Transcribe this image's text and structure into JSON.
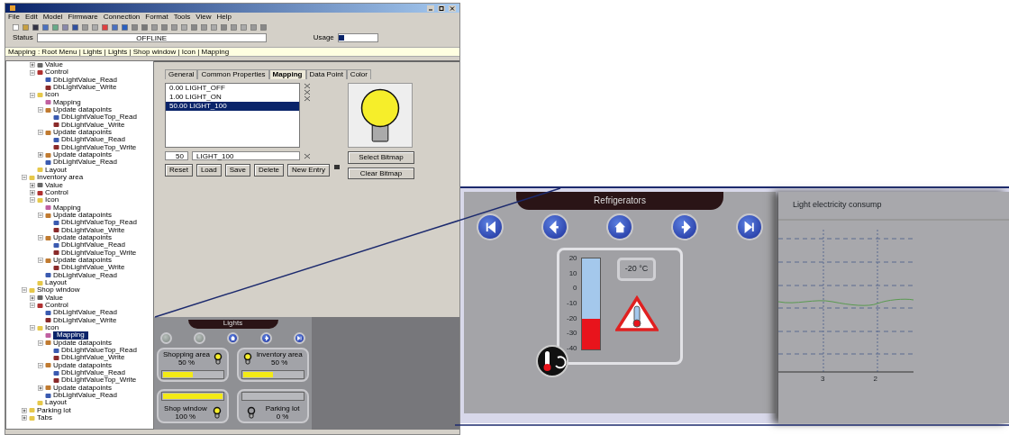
{
  "menu": [
    "File",
    "Edit",
    "Model",
    "Firmware",
    "Connection",
    "Format",
    "Tools",
    "View",
    "Help"
  ],
  "status_row": {
    "label": "Status",
    "value": "OFFLINE",
    "usage_label": "Usage"
  },
  "breadcrumb": "Mapping : Root Menu | Lights | Lights | Shop window | Icon | Mapping",
  "tree": {
    "continued_children": [
      {
        "label": "Value",
        "kind": "value",
        "expanded": false,
        "selected": false
      },
      {
        "label": "Control",
        "kind": "control",
        "expanded": true,
        "selected": false,
        "children": [
          {
            "label": "DbLightValue_Read",
            "kind": "read",
            "selected": false
          },
          {
            "label": "DbLightValue_Write",
            "kind": "write",
            "selected": false
          }
        ]
      },
      {
        "label": "Icon",
        "kind": "icon",
        "expanded": true,
        "selected": false,
        "children": [
          {
            "label": "Mapping",
            "kind": "mapping",
            "selected": false
          },
          {
            "label": "Update datapoints",
            "kind": "update",
            "expanded": true,
            "selected": false,
            "children": [
              {
                "label": "DbLightValueTop_Read",
                "kind": "read",
                "selected": false
              },
              {
                "label": "DbLightValue_Write",
                "kind": "write",
                "selected": false
              }
            ]
          },
          {
            "label": "Update datapoints",
            "kind": "update",
            "expanded": true,
            "selected": false,
            "children": [
              {
                "label": "DbLightValue_Read",
                "kind": "read",
                "selected": false
              },
              {
                "label": "DbLightValueTop_Write",
                "kind": "write",
                "selected": false
              }
            ]
          },
          {
            "label": "Update datapoints",
            "kind": "update",
            "expanded": false,
            "selected": false
          },
          {
            "label": "DbLightValue_Read",
            "kind": "read",
            "selected": false
          }
        ]
      },
      {
        "label": "Layout",
        "kind": "layout",
        "selected": false
      }
    ],
    "items": [
      {
        "label": "Inventory area",
        "kind": "folder",
        "expanded": true,
        "selected": false,
        "children": [
          {
            "label": "Value",
            "kind": "value",
            "expanded": false,
            "selected": false
          },
          {
            "label": "Control",
            "kind": "control",
            "expanded": false,
            "selected": false
          },
          {
            "label": "Icon",
            "kind": "icon",
            "expanded": true,
            "selected": false,
            "children": [
              {
                "label": "Mapping",
                "kind": "mapping",
                "selected": false
              },
              {
                "label": "Update datapoints",
                "kind": "update",
                "expanded": true,
                "selected": false,
                "children": [
                  {
                    "label": "DbLightValueTop_Read",
                    "kind": "read",
                    "selected": false
                  },
                  {
                    "label": "DbLightValue_Write",
                    "kind": "write",
                    "selected": false
                  }
                ]
              },
              {
                "label": "Update datapoints",
                "kind": "update",
                "expanded": true,
                "selected": false,
                "children": [
                  {
                    "label": "DbLightValue_Read",
                    "kind": "read",
                    "selected": false
                  },
                  {
                    "label": "DbLightValueTop_Write",
                    "kind": "write",
                    "selected": false
                  }
                ]
              },
              {
                "label": "Update datapoints",
                "kind": "update",
                "expanded": true,
                "selected": false,
                "children": [
                  {
                    "label": "DbLightValue_Write",
                    "kind": "write",
                    "selected": false
                  }
                ]
              },
              {
                "label": "DbLightValue_Read",
                "kind": "read",
                "selected": false
              }
            ]
          },
          {
            "label": "Layout",
            "kind": "layout",
            "selected": false
          }
        ]
      },
      {
        "label": "Shop window",
        "kind": "folder",
        "expanded": true,
        "selected": false,
        "children": [
          {
            "label": "Value",
            "kind": "value",
            "expanded": false,
            "selected": false
          },
          {
            "label": "Control",
            "kind": "control",
            "expanded": true,
            "selected": false,
            "children": [
              {
                "label": "DbLightValue_Read",
                "kind": "read",
                "selected": false
              },
              {
                "label": "DbLightValue_Write",
                "kind": "write",
                "selected": false
              }
            ]
          },
          {
            "label": "Icon",
            "kind": "icon",
            "expanded": true,
            "selected": false,
            "children": [
              {
                "label": "Mapping",
                "kind": "mapping",
                "selected": true
              },
              {
                "label": "Update datapoints",
                "kind": "update",
                "expanded": true,
                "selected": false,
                "children": [
                  {
                    "label": "DbLightValueTop_Read",
                    "kind": "read",
                    "selected": false
                  },
                  {
                    "label": "DbLightValue_Write",
                    "kind": "write",
                    "selected": false
                  }
                ]
              },
              {
                "label": "Update datapoints",
                "kind": "update",
                "expanded": true,
                "selected": false,
                "children": [
                  {
                    "label": "DbLightValue_Read",
                    "kind": "read",
                    "selected": false
                  },
                  {
                    "label": "DbLightValueTop_Write",
                    "kind": "write",
                    "selected": false
                  }
                ]
              },
              {
                "label": "Update datapoints",
                "kind": "update",
                "expanded": false,
                "selected": false
              },
              {
                "label": "DbLightValue_Read",
                "kind": "read",
                "selected": false
              }
            ]
          },
          {
            "label": "Layout",
            "kind": "layout",
            "selected": false
          }
        ]
      },
      {
        "label": "Parking lot",
        "kind": "folder",
        "expanded": false,
        "selected": false
      },
      {
        "label": "Tabs",
        "kind": "folder",
        "expanded": false,
        "selected": false
      }
    ]
  },
  "tabs": [
    {
      "label": "General",
      "selected": false
    },
    {
      "label": "Common Properties",
      "selected": false
    },
    {
      "label": "Mapping",
      "selected": true
    },
    {
      "label": "Data Point",
      "selected": false
    },
    {
      "label": "Color",
      "selected": false
    }
  ],
  "mapping_list": [
    {
      "value": "0.00",
      "name": "LIGHT_OFF",
      "selected": false
    },
    {
      "value": "1.00",
      "name": "LIGHT_ON",
      "selected": false
    },
    {
      "value": "50.00",
      "name": "LIGHT_100",
      "selected": true
    }
  ],
  "entry": {
    "value": "50",
    "name": "LIGHT_100"
  },
  "list_buttons": [
    "Reset",
    "Load",
    "Save",
    "Delete",
    "New Entry"
  ],
  "bitmap_buttons": [
    "Select Bitmap",
    "Clear Bitmap"
  ],
  "lights_panel": {
    "title": "Lights",
    "nav": [
      {
        "kind": "first",
        "disabled": true
      },
      {
        "kind": "prev",
        "disabled": true
      },
      {
        "kind": "home",
        "disabled": false
      },
      {
        "kind": "next",
        "disabled": false
      },
      {
        "kind": "last",
        "disabled": false
      }
    ],
    "tiles": [
      {
        "name": "Shopping area",
        "reading": "50 %",
        "level": 0.5,
        "on": true
      },
      {
        "name": "Inventory area",
        "reading": "50 %",
        "level": 0.5,
        "on": true
      },
      {
        "name": "Shop window",
        "reading": "100 %",
        "level": 1,
        "on": true
      },
      {
        "name": "Parking lot",
        "reading": "0 %",
        "level": 0,
        "on": false
      }
    ]
  },
  "refrigerators": {
    "title": "Refrigerators",
    "nav": [
      {
        "kind": "first",
        "disabled": false
      },
      {
        "kind": "prev",
        "disabled": false
      },
      {
        "kind": "home",
        "disabled": false
      },
      {
        "kind": "next",
        "disabled": false
      },
      {
        "kind": "last",
        "disabled": false
      }
    ],
    "scale": [
      "20",
      "10",
      "0",
      "-10",
      "-20",
      "-30",
      "-40"
    ],
    "level": 0.333,
    "reading": "-20 °C",
    "alarm": true
  },
  "chart_panel": {
    "title": "Light electricity consump",
    "x_labels": [
      "3",
      "2"
    ]
  }
}
